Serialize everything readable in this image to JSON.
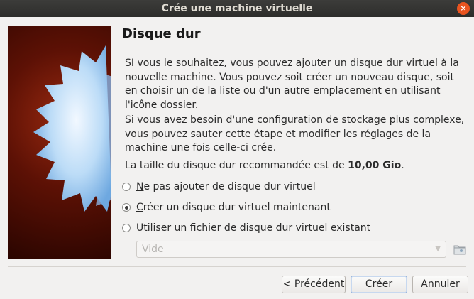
{
  "window": {
    "title": "Crée une machine virtuelle",
    "close_glyph": "×"
  },
  "page": {
    "heading": "Disque dur",
    "paragraph1": "SI vous le souhaitez, vous pouvez ajouter un disque dur virtuel à la nouvelle machine. Vous pouvez soit créer un nouveau disque, soit en choisir un de la liste ou d'un autre emplacement en utilisant l'icône dossier.",
    "paragraph2": "Si vous avez besoin d'une configuration de stockage plus complexe, vous pouvez sauter cette étape et modifier les réglages de la machine une fois celle-ci crée.",
    "size_prefix": "La taille du disque dur recommandée est de ",
    "size_value": "10,00 Gio",
    "size_suffix": "."
  },
  "options": [
    {
      "mnemonic": "N",
      "rest": "e pas ajouter de disque dur virtuel",
      "checked": false
    },
    {
      "mnemonic": "C",
      "rest": "réer un disque dur virtuel maintenant",
      "checked": true
    },
    {
      "mnemonic": "U",
      "rest": "tiliser un fichier de disque dur virtuel existant",
      "checked": false
    }
  ],
  "disk_combo": {
    "value": "Vide",
    "enabled": false,
    "icon": "folder-icon"
  },
  "buttons": {
    "back_prefix": "< ",
    "back_mnemonic": "P",
    "back_rest": "récédent",
    "create": "Créer",
    "cancel": "Annuler"
  },
  "colors": {
    "titlebar": "#2d2d2b",
    "close": "#e95420",
    "banner": "#5d1105",
    "star": "#a8d0f5"
  }
}
